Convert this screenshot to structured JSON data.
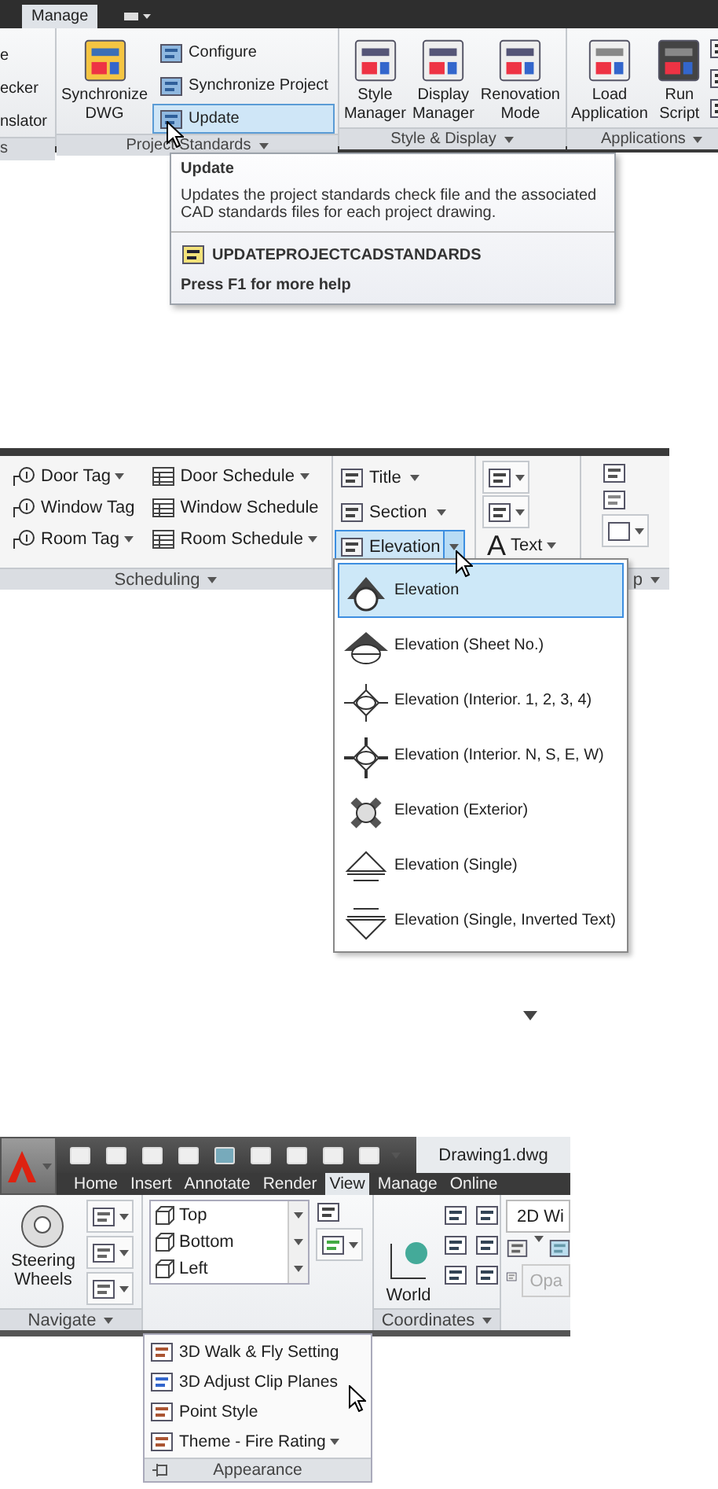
{
  "ribbon_1": {
    "tabs": [
      {
        "label": "Manage",
        "selected": true
      }
    ],
    "cut_panel": {
      "items": [
        "e",
        "ecker",
        "nslator"
      ],
      "title": "s"
    },
    "project_standards": {
      "large_button": "Synchronize DWG",
      "items": [
        {
          "label": "Configure",
          "selected": false
        },
        {
          "label": "Synchronize Project",
          "selected": false
        },
        {
          "label": "Update",
          "selected": true
        }
      ],
      "title": "Project Standards"
    },
    "style_display": {
      "buttons": [
        "Style Manager",
        "Display Manager",
        "Renovation Mode"
      ],
      "title": "Style & Display"
    },
    "applications": {
      "buttons": [
        "Load Application",
        "Run Script"
      ],
      "title": "Applications"
    },
    "tooltip": {
      "title": "Update",
      "description": "Updates the project standards check file and the associated CAD standards files for each project drawing.",
      "command": "UPDATEPROJECTCADSTANDARDS",
      "help": "Press F1 for more help"
    }
  },
  "ribbon_2": {
    "tags": [
      {
        "label": "Door Tag",
        "has_menu": true
      },
      {
        "label": "Window Tag",
        "has_menu": false
      },
      {
        "label": "Room Tag",
        "has_menu": true
      }
    ],
    "schedules": [
      {
        "label": "Door Schedule",
        "has_menu": true
      },
      {
        "label": "Window Schedule",
        "has_menu": false
      },
      {
        "label": "Room Schedule",
        "has_menu": true
      }
    ],
    "callouts": [
      {
        "label": "Title",
        "selected": false
      },
      {
        "label": "Section",
        "selected": false
      },
      {
        "label": "Elevation",
        "selected": true
      }
    ],
    "text_button": {
      "glyph": "A",
      "label": "Text"
    },
    "titles": [
      "Scheduling",
      "p"
    ],
    "elevation_menu": [
      {
        "label": "Elevation",
        "selected": true
      },
      {
        "label": "Elevation (Sheet No.)",
        "selected": false
      },
      {
        "label": "Elevation (Interior. 1, 2, 3, 4)",
        "selected": false
      },
      {
        "label": "Elevation (Interior. N, S, E, W)",
        "selected": false
      },
      {
        "label": "Elevation (Exterior)",
        "selected": false
      },
      {
        "label": "Elevation (Single)",
        "selected": false
      },
      {
        "label": "Elevation (Single, Inverted Text)",
        "selected": false
      }
    ]
  },
  "ribbon_3": {
    "title": "Drawing1.dwg",
    "tabs": [
      {
        "label": "Home",
        "selected": false
      },
      {
        "label": "Insert",
        "selected": false
      },
      {
        "label": "Annotate",
        "selected": false
      },
      {
        "label": "Render",
        "selected": false
      },
      {
        "label": "View",
        "selected": true
      },
      {
        "label": "Manage",
        "selected": false
      },
      {
        "label": "Online",
        "selected": false
      }
    ],
    "navigate": {
      "button": "Steering Wheels",
      "title": "Navigate"
    },
    "views": [
      "Top",
      "Bottom",
      "Left"
    ],
    "coordinates": {
      "button": "World",
      "title": "Coordinates"
    },
    "visual_style": "2D Wi",
    "disabled_button": "Opa",
    "appearance": {
      "items": [
        "3D Walk & Fly Setting",
        "3D Adjust Clip Planes",
        "Point Style",
        "Theme - Fire Rating"
      ],
      "title": "Appearance"
    }
  }
}
